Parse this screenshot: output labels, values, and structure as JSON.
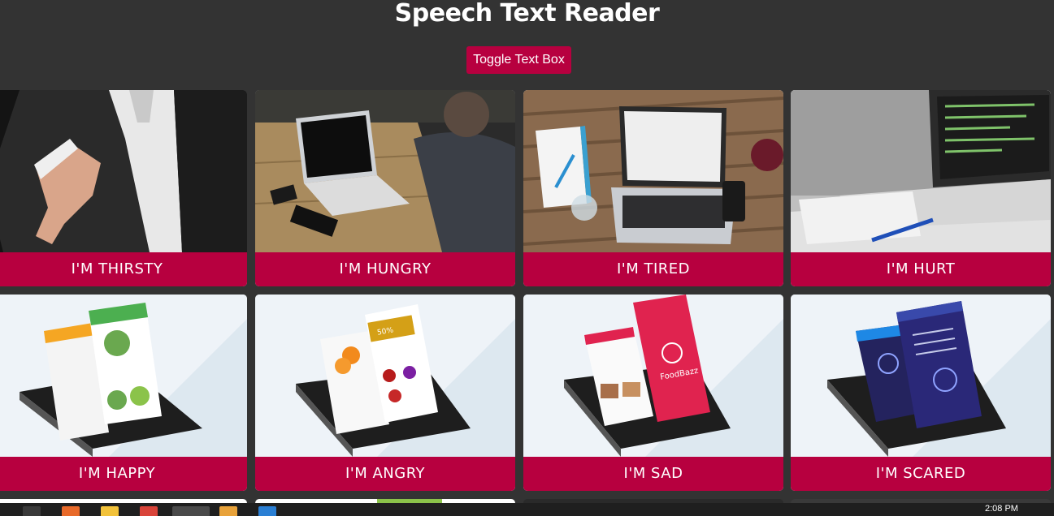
{
  "page": {
    "title": "Speech Text Reader"
  },
  "toolbar": {
    "toggle_label": "Toggle Text Box"
  },
  "colors": {
    "background": "#333333",
    "accent": "#b7003f",
    "card_bg": "#eef3f8"
  },
  "cards": [
    {
      "caption": "I'M THIRSTY",
      "image": "handshake-photo"
    },
    {
      "caption": "I'M HUNGRY",
      "image": "laptop-desk-photo"
    },
    {
      "caption": "I'M TIRED",
      "image": "laptop-wood-photo"
    },
    {
      "caption": "I'M HURT",
      "image": "laptop-notebook-photo"
    },
    {
      "caption": "I'M HAPPY",
      "image": "phone-app-mockup"
    },
    {
      "caption": "I'M ANGRY",
      "image": "phone-grocery-mockup"
    },
    {
      "caption": "I'M SAD",
      "image": "phone-foodbazz-mockup"
    },
    {
      "caption": "I'M SCARED",
      "image": "phone-dashboard-mockup"
    }
  ],
  "mockup_text": {
    "brand": "FoodBazz",
    "discount": "50%"
  },
  "taskbar": {
    "clock": "2:08 PM"
  }
}
